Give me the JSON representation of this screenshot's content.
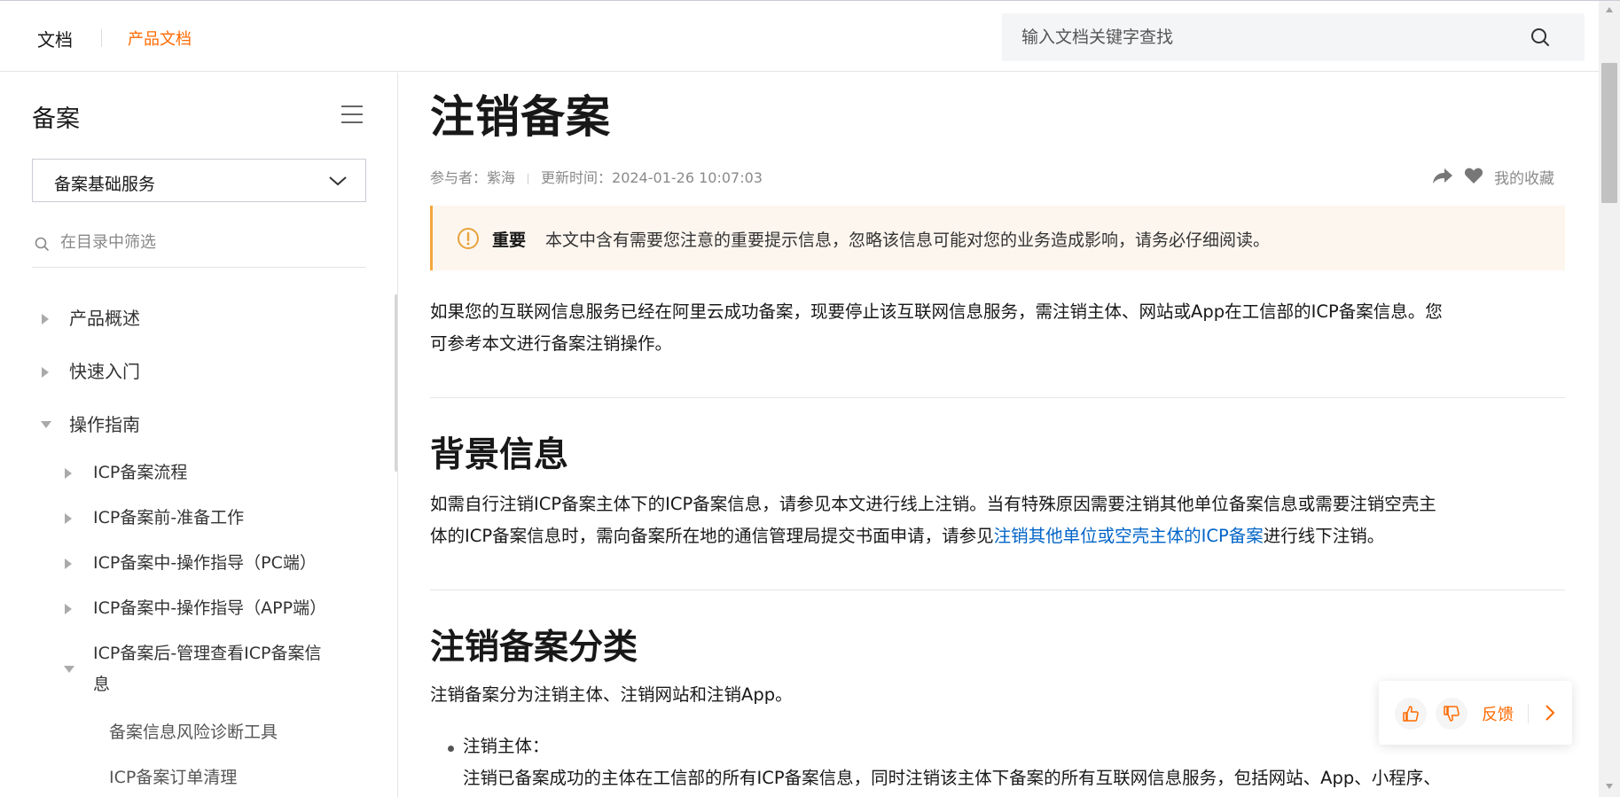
{
  "header": {
    "brand": "文档",
    "product": "产品文档",
    "search_placeholder": "输入文档关键字查找"
  },
  "sidebar": {
    "title": "备案",
    "select_value": "备案基础服务",
    "filter_placeholder": "在目录中筛选",
    "items": [
      {
        "label": "产品概述",
        "expanded": false
      },
      {
        "label": "快速入门",
        "expanded": false
      },
      {
        "label": "操作指南",
        "expanded": true
      }
    ],
    "sub_items": [
      {
        "label": "ICP备案流程",
        "expanded": false
      },
      {
        "label": "ICP备案前-准备工作",
        "expanded": false
      },
      {
        "label": "ICP备案中-操作指导（PC端）",
        "expanded": false
      },
      {
        "label": "ICP备案中-操作指导（APP端）",
        "expanded": false
      },
      {
        "label_line1": "ICP备案后-管理查看ICP备案信",
        "label_line2": "息",
        "expanded": true
      }
    ],
    "leaf_items": [
      {
        "label": "备案信息风险诊断工具"
      },
      {
        "label": "ICP备案订单清理"
      }
    ]
  },
  "article": {
    "title": "注销备案",
    "meta": {
      "contributors": "参与者：紫海",
      "updated": "更新时间：2024-01-26 10:07:03",
      "favorites": "我的收藏"
    },
    "notice": {
      "title": "重要",
      "text": "本文中含有需要您注意的重要提示信息，忽略该信息可能对您的业务造成影响，请务必仔细阅读。"
    },
    "intro_line1": "如果您的互联网信息服务已经在阿里云成功备案，现要停止该互联网信息服务，需注销主体、网站或App在工信部的ICP备案信息。您",
    "intro_line2": "可参考本文进行备案注销操作。",
    "section1_title": "背景信息",
    "section1_line1": "如需自行注销ICP备案主体下的ICP备案信息，请参见本文进行线上注销。当有特殊原因需要注销其他单位备案信息或需要注销空壳主",
    "section1_line2_pre": "体的ICP备案信息时，需向备案所在地的通信管理局提交书面申请，请参见",
    "section1_link": "注销其他单位或空壳主体的ICP备案",
    "section1_line2_post": "进行线下注销。",
    "section2_title": "注销备案分类",
    "section2_text": "注销备案分为注销主体、注销网站和注销App。",
    "bullet1_title": "注销主体：",
    "bullet1_text": "注销已备案成功的主体在工信部的所有ICP备案信息，同时注销该主体下备案的所有互联网信息服务，包括网站、App、小程序、"
  },
  "feedback": {
    "label": "反馈"
  },
  "colors": {
    "accent": "#ff6a00",
    "link": "#0064c8",
    "notice_bg": "#fdf6ef",
    "notice_border": "#f2a83b"
  }
}
